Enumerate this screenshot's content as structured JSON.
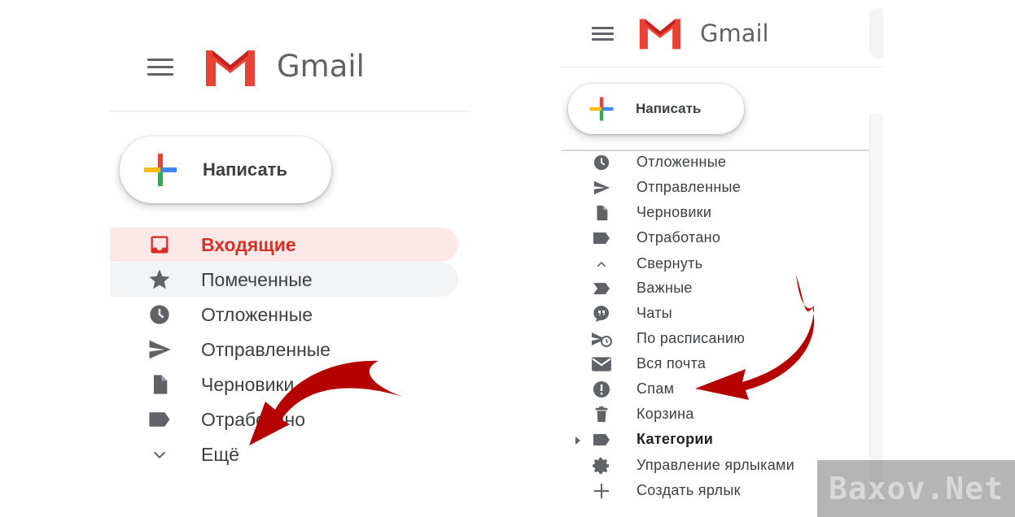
{
  "left": {
    "brand": "Gmail",
    "compose_label": "Написать",
    "items": [
      {
        "label": "Входящие",
        "icon": "inbox-icon"
      },
      {
        "label": "Помеченные",
        "icon": "star-icon"
      },
      {
        "label": "Отложенные",
        "icon": "clock-icon"
      },
      {
        "label": "Отправленные",
        "icon": "send-icon"
      },
      {
        "label": "Черновики",
        "icon": "draft-icon"
      },
      {
        "label": "Отработано",
        "icon": "label-icon"
      },
      {
        "label": "Ещё",
        "icon": "chevron-down-icon"
      }
    ]
  },
  "right": {
    "brand": "Gmail",
    "compose_label": "Написать",
    "items": [
      {
        "label": "Отложенные",
        "icon": "clock-icon"
      },
      {
        "label": "Отправленные",
        "icon": "send-icon"
      },
      {
        "label": "Черновики",
        "icon": "draft-icon"
      },
      {
        "label": "Отработано",
        "icon": "label-icon"
      },
      {
        "label": "Свернуть",
        "icon": "chevron-up-icon"
      },
      {
        "label": "Важные",
        "icon": "important-icon"
      },
      {
        "label": "Чаты",
        "icon": "chat-icon"
      },
      {
        "label": "По расписанию",
        "icon": "scheduled-icon"
      },
      {
        "label": "Вся почта",
        "icon": "mail-icon"
      },
      {
        "label": "Спам",
        "icon": "spam-icon"
      },
      {
        "label": "Корзина",
        "icon": "trash-icon"
      },
      {
        "label": "Категории",
        "icon": "label-icon"
      },
      {
        "label": "Управление ярлыками",
        "icon": "gear-icon"
      },
      {
        "label": "Создать ярлык",
        "icon": "plus-icon"
      }
    ]
  },
  "watermark": "Baxov.Net",
  "colors": {
    "accent_red": "#d93025",
    "active_bg": "#fce8e6",
    "hover_bg": "#f1f3f4",
    "icon_gray": "#5f6368",
    "arrow_red": "#b50000"
  }
}
